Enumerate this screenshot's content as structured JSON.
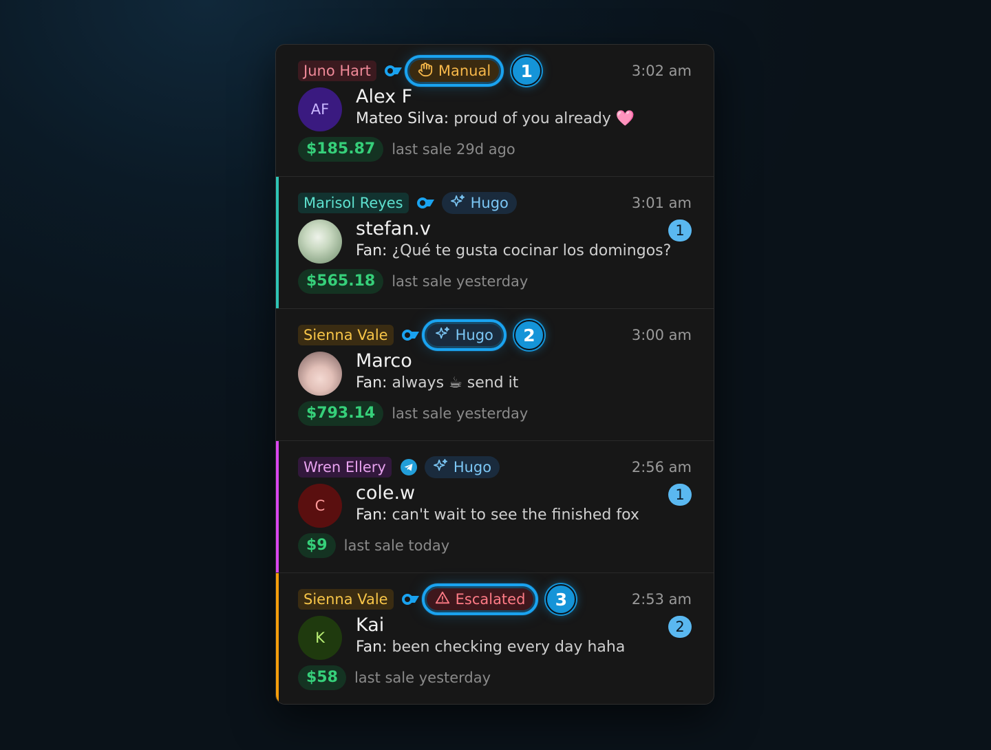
{
  "colors": {
    "accent_focus": "#1aa3f0",
    "amount_green": "#36d07a",
    "unread_blue": "#5ab8f0"
  },
  "conversations": [
    {
      "agent": "Juno Hart",
      "agent_color": "red",
      "platform_icon": "onlyfans-icon",
      "mode": "Manual",
      "mode_icon": "hand-icon",
      "focused": true,
      "step": "1",
      "time": "3:02 am",
      "avatar_initials": "AF",
      "contact_name": "Alex F",
      "sender": "Mateo Silva:",
      "message": "proud of you already 🩷",
      "unread": "",
      "amount": "$185.87",
      "last_sale": "last sale 29d ago",
      "accent": ""
    },
    {
      "agent": "Marisol Reyes",
      "agent_color": "teal",
      "platform_icon": "onlyfans-icon",
      "mode": "Hugo",
      "mode_icon": "sparkle-icon",
      "focused": false,
      "step": "",
      "time": "3:01 am",
      "avatar_initials": "",
      "contact_name": "stefan.v",
      "sender": "Fan:",
      "message": "¿Qué te gusta cocinar los domingos?",
      "unread": "1",
      "amount": "$565.18",
      "last_sale": "last sale yesterday",
      "accent": "#2ec4b6"
    },
    {
      "agent": "Sienna Vale",
      "agent_color": "yellow",
      "platform_icon": "onlyfans-icon",
      "mode": "Hugo",
      "mode_icon": "sparkle-icon",
      "focused": true,
      "step": "2",
      "time": "3:00 am",
      "avatar_initials": "",
      "contact_name": "Marco",
      "sender": "Fan:",
      "message": "always ☕ send it",
      "unread": "",
      "amount": "$793.14",
      "last_sale": "last sale yesterday",
      "accent": ""
    },
    {
      "agent": "Wren Ellery",
      "agent_color": "purple",
      "platform_icon": "telegram-icon",
      "mode": "Hugo",
      "mode_icon": "sparkle-icon",
      "focused": false,
      "step": "",
      "time": "2:56 am",
      "avatar_initials": "C",
      "contact_name": "cole.w",
      "sender": "Fan:",
      "message": "can't wait to see the finished fox",
      "unread": "1",
      "amount": "$9",
      "last_sale": "last sale today",
      "accent": "#d946ef"
    },
    {
      "agent": "Sienna Vale",
      "agent_color": "yellow",
      "platform_icon": "onlyfans-icon",
      "mode": "Escalated",
      "mode_icon": "warning-icon",
      "focused": true,
      "step": "3",
      "time": "2:53 am",
      "avatar_initials": "K",
      "contact_name": "Kai",
      "sender": "Fan:",
      "message": "been checking every day haha",
      "unread": "2",
      "amount": "$58",
      "last_sale": "last sale yesterday",
      "accent": "#f59e0b"
    }
  ]
}
